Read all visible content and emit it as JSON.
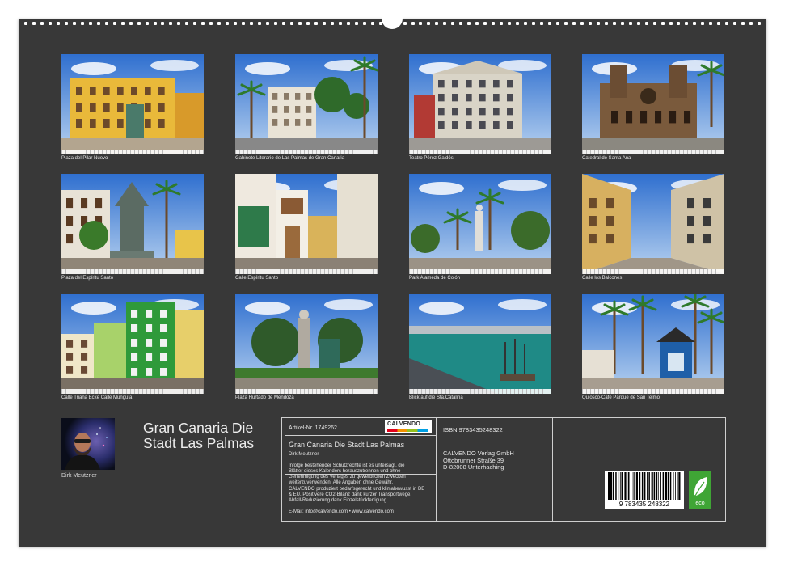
{
  "photos": [
    {
      "caption": "Plaza del Pilar Nuevo",
      "scene": "yellow-facade"
    },
    {
      "caption": "Gabinete Literario de Las Palmas de Gran Canaria",
      "scene": "palms-building"
    },
    {
      "caption": "Teatro Pérez Galdós",
      "scene": "theatre"
    },
    {
      "caption": "Catedral de Santa Ana",
      "scene": "cathedral"
    },
    {
      "caption": "Plaza del Espíritu Santo",
      "scene": "fountain"
    },
    {
      "caption": "Calle Espíritu Santo",
      "scene": "street-green"
    },
    {
      "caption": "Park Alameda de Colón",
      "scene": "park"
    },
    {
      "caption": "Calle los Balcones",
      "scene": "street-cobble"
    },
    {
      "caption": "Calle Triana Ecke Calle Munguía",
      "scene": "colorful-houses"
    },
    {
      "caption": "Plaza Hurtado de Mendoza",
      "scene": "statue-park"
    },
    {
      "caption": "Blick auf die Sta.Catalina",
      "scene": "harbour"
    },
    {
      "caption": "Quiosco-Café Parque de San Telmo",
      "scene": "kiosk"
    }
  ],
  "calendar_title_line1": "Gran Canaria Die",
  "calendar_title_line2": "Stadt Las Palmas",
  "author": "Dirk Meutzner",
  "info": {
    "article": "Artikel-Nr. 1749262",
    "logo": "CALVENDO",
    "title": "Gran Canaria Die Stadt Las Palmas",
    "author": "Dirk Meutzner",
    "legal": [
      "Infolge bestehender Schutzrechte ist es untersagt, die",
      "Blätter dieses Kalenders herauszutrennen und ohne",
      "Genehmigung des Verlages zu gewerblichen Zwecken",
      "weiterzuverwenden. Alle Angaben ohne Gewähr."
    ],
    "eco_text": [
      "CALVENDO produziert bedarfsgerecht und klimabewusst in DE",
      "& EU. Positivere CO2-Bilanz dank kurzer Transportwege.",
      "Abfall-Reduzierung dank Einzelstückfertigung."
    ],
    "contact": "E-Mail: info@calvendo.com • www.calvendo.com",
    "isbn": "ISBN 9783435248322",
    "publisher": [
      "CALVENDO Verlag GmbH",
      "Ottobrunner Straße 39",
      "D-82008 Unterhaching"
    ],
    "barcode_digits": "9 783435 248322",
    "eco_label": "eco"
  },
  "colors": {
    "background": "#383838",
    "paper": "#ffffff",
    "eco": "#3fa535"
  }
}
